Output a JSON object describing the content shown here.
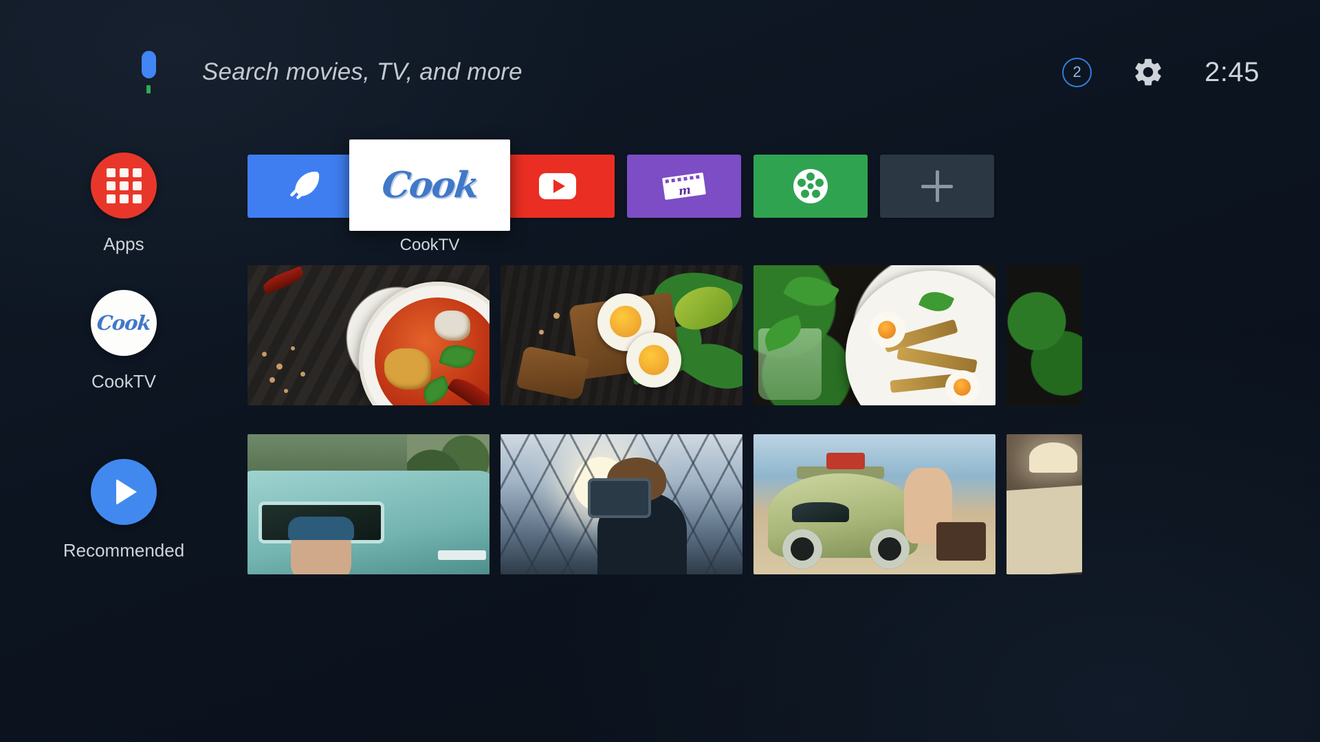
{
  "header": {
    "mic_icon": "google-mic-icon",
    "search_placeholder": "Search movies, TV, and more",
    "notification_count": "2",
    "gear_icon": "gear-icon",
    "clock": "2:45",
    "accent_blue": "#2f7ee0"
  },
  "sidebar": {
    "items": [
      {
        "label": "Apps",
        "icon": "apps-grid-icon",
        "circle_color": "#e8372a"
      },
      {
        "label": "CookTV",
        "icon": "cook-logo-icon",
        "circle_color": "#fdfdfb",
        "logo_text": "Cook"
      },
      {
        "label": "Recommended",
        "icon": "play-icon",
        "circle_color": "#4189ef"
      }
    ]
  },
  "app_row": {
    "focused_label": "CookTV",
    "focused_logo_text": "Cook",
    "tiles": [
      {
        "name": "feather-app",
        "icon": "feather-icon",
        "color": "#3f7ef0"
      },
      {
        "name": "cooktv-app",
        "icon": "cook-logo-icon",
        "color": "#ffffff",
        "focused": true
      },
      {
        "name": "youtube-app",
        "icon": "play-badge-icon",
        "color": "#ea2e23"
      },
      {
        "name": "movies-app",
        "icon": "film-strip-m-icon",
        "color": "#7c4dc4"
      },
      {
        "name": "reel-app",
        "icon": "film-reel-icon",
        "color": "#30a351"
      },
      {
        "name": "add-app",
        "icon": "plus-icon",
        "color": "#2c3744"
      }
    ]
  },
  "content_rows": [
    {
      "name": "cooktv-row",
      "thumbnails": [
        {
          "name": "red-curry-soup-bowl"
        },
        {
          "name": "egg-avocado-toast"
        },
        {
          "name": "chicken-caesar-salad-plate"
        },
        {
          "name": "dark-leafy-greens"
        }
      ]
    },
    {
      "name": "recommended-row",
      "thumbnails": [
        {
          "name": "woman-in-teal-pickup-truck"
        },
        {
          "name": "person-with-binoculars-city"
        },
        {
          "name": "vw-beetle-on-beach"
        },
        {
          "name": "road-map-on-table"
        }
      ]
    }
  ]
}
